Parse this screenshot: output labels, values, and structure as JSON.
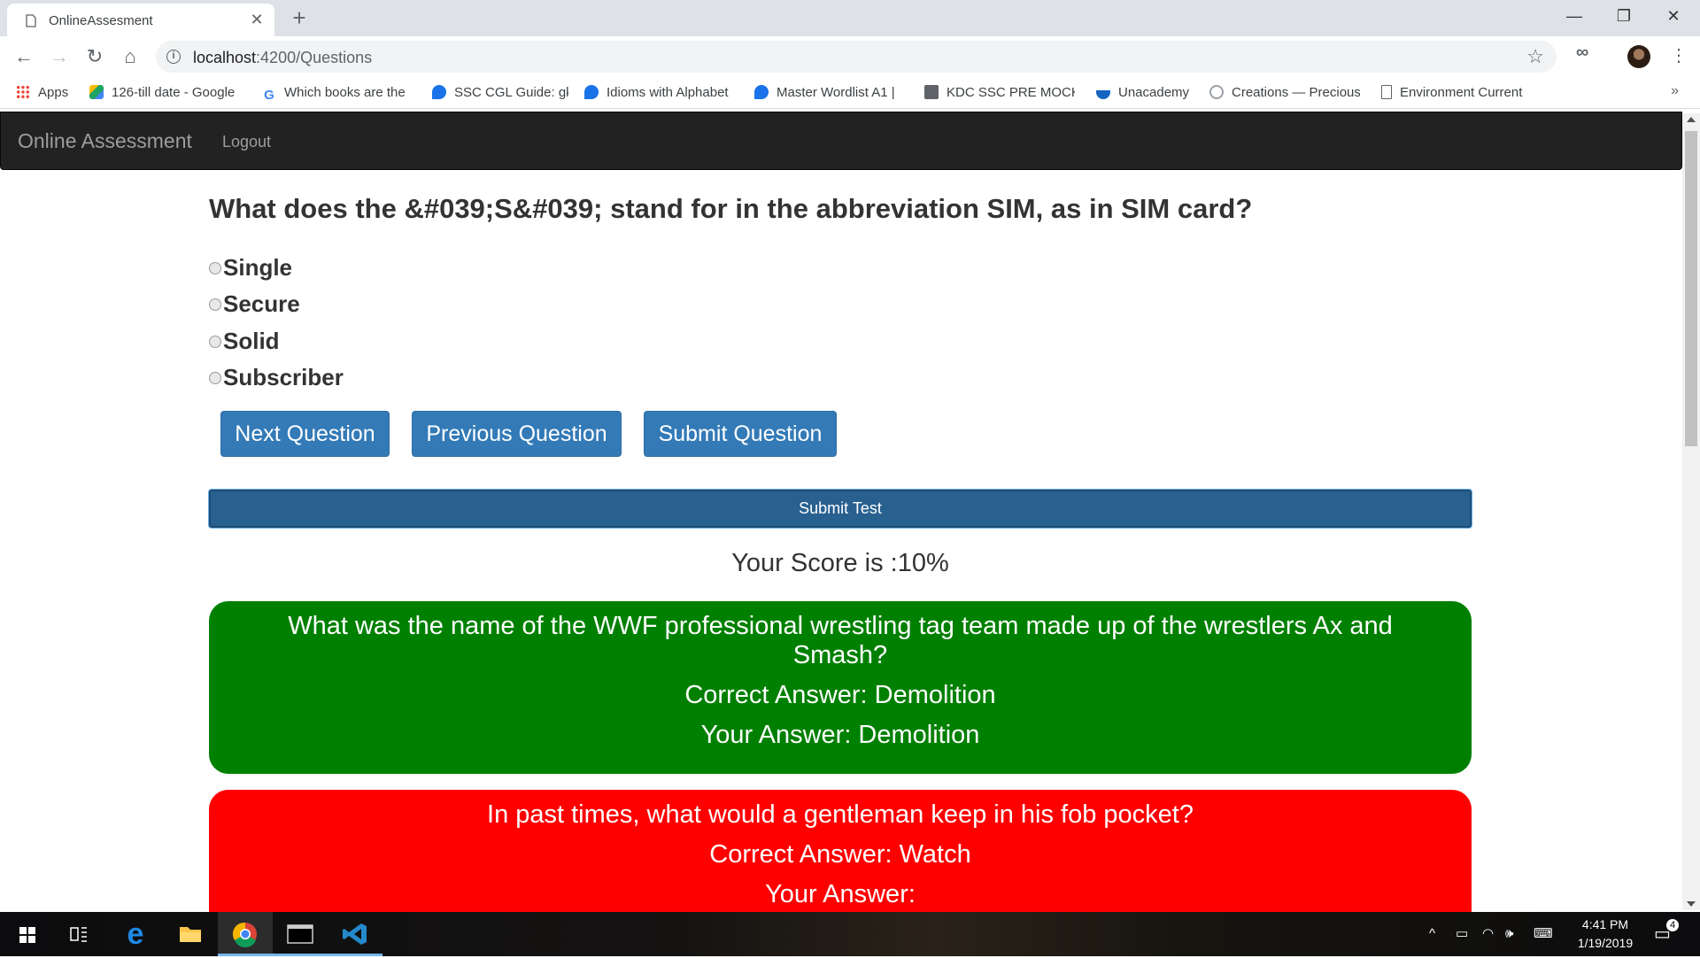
{
  "browser": {
    "tab_title": "OnlineAssesment",
    "url_host": "localhost",
    "url_path": ":4200/Questions",
    "bookmarks": [
      {
        "label": "Apps",
        "color": "#ea4335"
      },
      {
        "label": "126-till date - Google",
        "color": "#1fa463"
      },
      {
        "label": "Which books are the",
        "color": "#4285f4"
      },
      {
        "label": "SSC CGL Guide: gk",
        "color": "#1a73e8"
      },
      {
        "label": "Idioms with Alphabet",
        "color": "#1a73e8"
      },
      {
        "label": "Master Wordlist A1 |",
        "color": "#1a73e8"
      },
      {
        "label": "KDC SSC PRE MOCK",
        "color": "#5f6368"
      },
      {
        "label": "Unacademy",
        "color": "#1565c0"
      },
      {
        "label": "Creations — Precious",
        "color": "#9aa0a6"
      },
      {
        "label": "Environment Current",
        "color": "#5f6368"
      }
    ],
    "more_bookmarks": "»"
  },
  "navbar": {
    "brand": "Online Assessment",
    "logout": "Logout"
  },
  "quiz": {
    "question": "What does the &#039;S&#039; stand for in the abbreviation SIM, as in SIM card?",
    "options": [
      "Single",
      "Secure",
      "Solid",
      "Subscriber"
    ],
    "buttons": {
      "next": "Next Question",
      "previous": "Previous Question",
      "submit": "Submit Question"
    },
    "submit_test": "Submit Test",
    "score": "Your Score is :10%"
  },
  "results": [
    {
      "question": "What was the name of the WWF professional wrestling tag team made up of the wrestlers Ax and Smash?",
      "correct_answer": "Correct Answer: Demolition",
      "your_answer": "Your Answer: Demolition",
      "status_color": "#008000"
    },
    {
      "question": "In past times, what would a gentleman keep in his fob pocket?",
      "correct_answer": "Correct Answer: Watch",
      "your_answer": "Your Answer:",
      "status_color": "#ff0000"
    }
  ],
  "taskbar": {
    "time": "4:41 PM",
    "date": "1/19/2019",
    "notification_count": "4"
  }
}
